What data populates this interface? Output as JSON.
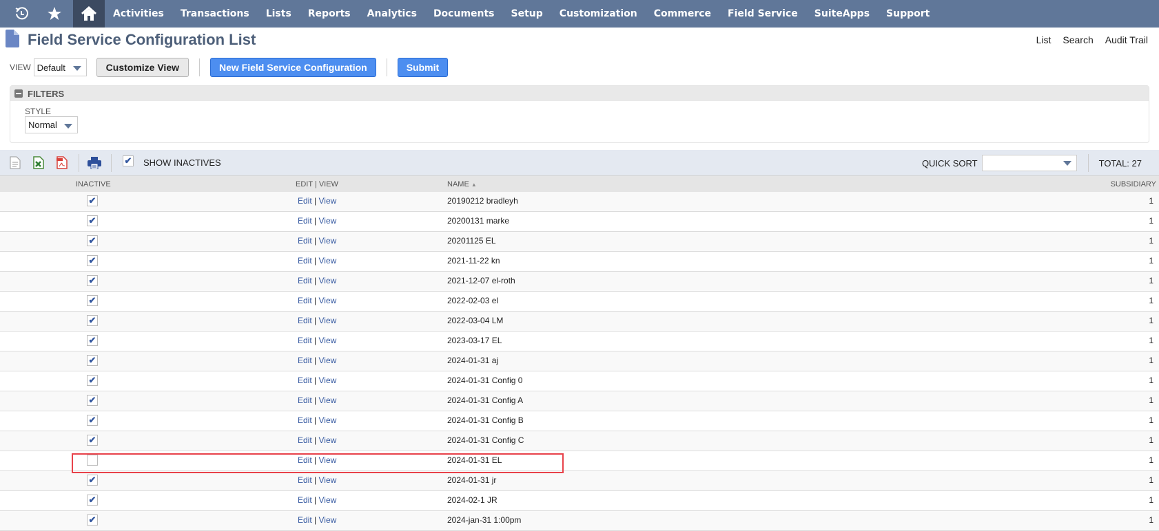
{
  "nav": {
    "icons": [
      "recent-icon",
      "star-icon",
      "home-icon"
    ],
    "items": [
      "Activities",
      "Transactions",
      "Lists",
      "Reports",
      "Analytics",
      "Documents",
      "Setup",
      "Customization",
      "Commerce",
      "Field Service",
      "SuiteApps",
      "Support"
    ]
  },
  "page": {
    "title": "Field Service Configuration List",
    "links": [
      "List",
      "Search",
      "Audit Trail"
    ]
  },
  "controls": {
    "view_label": "VIEW",
    "view_value": "Default",
    "customize_view": "Customize View",
    "new_button": "New Field Service Configuration",
    "submit": "Submit"
  },
  "filters": {
    "header": "FILTERS",
    "style_label": "STYLE",
    "style_value": "Normal"
  },
  "toolbar": {
    "show_inactives_label": "SHOW INACTIVES",
    "show_inactives_checked": true,
    "quick_sort_label": "QUICK SORT",
    "quick_sort_value": "",
    "total": "TOTAL: 27"
  },
  "table": {
    "headers": {
      "inactive": "INACTIVE",
      "edit_view": "EDIT | VIEW",
      "name": "NAME",
      "name_sort": "▲",
      "subsidiary": "SUBSIDIARY"
    },
    "edit_label": "Edit",
    "separator": "|",
    "view_label": "View",
    "rows": [
      {
        "inactive": true,
        "name": "20190212 bradleyh",
        "subsidiary": "1"
      },
      {
        "inactive": true,
        "name": "20200131 marke",
        "subsidiary": "1"
      },
      {
        "inactive": true,
        "name": "20201125 EL",
        "subsidiary": "1"
      },
      {
        "inactive": true,
        "name": "2021-11-22 kn",
        "subsidiary": "1"
      },
      {
        "inactive": true,
        "name": "2021-12-07 el-roth",
        "subsidiary": "1"
      },
      {
        "inactive": true,
        "name": "2022-02-03 el",
        "subsidiary": "1"
      },
      {
        "inactive": true,
        "name": "2022-03-04 LM",
        "subsidiary": "1"
      },
      {
        "inactive": true,
        "name": "2023-03-17 EL",
        "subsidiary": "1"
      },
      {
        "inactive": true,
        "name": "2024-01-31 aj",
        "subsidiary": "1"
      },
      {
        "inactive": true,
        "name": "2024-01-31 Config 0",
        "subsidiary": "1"
      },
      {
        "inactive": true,
        "name": "2024-01-31 Config A",
        "subsidiary": "1"
      },
      {
        "inactive": true,
        "name": "2024-01-31 Config B",
        "subsidiary": "1"
      },
      {
        "inactive": true,
        "name": "2024-01-31 Config C",
        "subsidiary": "1"
      },
      {
        "inactive": false,
        "name": "2024-01-31 EL",
        "subsidiary": "1"
      },
      {
        "inactive": true,
        "name": "2024-01-31 jr",
        "subsidiary": "1"
      },
      {
        "inactive": true,
        "name": "2024-02-1 JR",
        "subsidiary": "1"
      },
      {
        "inactive": true,
        "name": "2024-jan-31 1:00pm",
        "subsidiary": "1"
      }
    ]
  },
  "colors": {
    "nav_bg": "#607799",
    "primary_button": "#4d8ef0",
    "highlight": "#e8424a"
  }
}
